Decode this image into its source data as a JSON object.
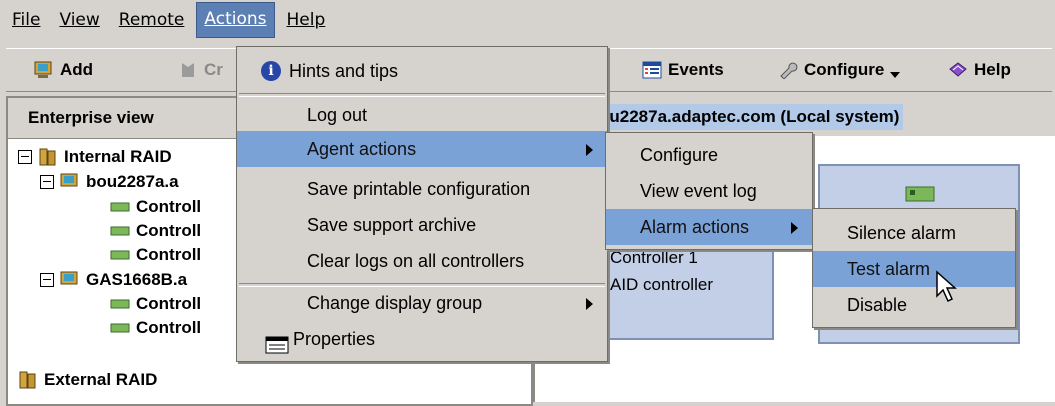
{
  "menubar": {
    "items": [
      {
        "label": "File"
      },
      {
        "label": "View"
      },
      {
        "label": "Remote"
      },
      {
        "label": "Actions"
      },
      {
        "label": "Help"
      }
    ]
  },
  "toolbar": {
    "add_label": "Add",
    "create_label": "Cr",
    "events_label": "Events",
    "configure_label": "Configure",
    "help_label": "Help"
  },
  "enterprise": {
    "title": "Enterprise view",
    "tree": [
      {
        "label": "Internal RAID"
      },
      {
        "label": "bou2287a.a"
      },
      {
        "label": "Controll"
      },
      {
        "label": "Controll"
      },
      {
        "label": "Controll"
      },
      {
        "label": "GAS1668B.a"
      },
      {
        "label": "Controll"
      },
      {
        "label": "Controll"
      },
      {
        "label": "External RAID"
      }
    ]
  },
  "right": {
    "header": "ou2287a.adaptec.com (Local system)",
    "card_line1": "Controller 1",
    "card_line2": "AID controller"
  },
  "actions_menu": {
    "items": [
      {
        "label": "Hints and tips"
      },
      {
        "label": "Log out"
      },
      {
        "label": "Agent actions"
      },
      {
        "label": "Save printable configuration"
      },
      {
        "label": "Save support archive"
      },
      {
        "label": "Clear logs on all controllers"
      },
      {
        "label": "Change display group"
      },
      {
        "label": "Properties"
      }
    ]
  },
  "agent_menu": {
    "items": [
      {
        "label": "Configure"
      },
      {
        "label": "View event log"
      },
      {
        "label": "Alarm actions"
      }
    ]
  },
  "alarm_menu": {
    "items": [
      {
        "label": "Silence alarm"
      },
      {
        "label": "Test alarm"
      },
      {
        "label": "Disable"
      }
    ]
  },
  "colors": {
    "highlight": "#7aa2d7",
    "window_bg": "#d6d3ce",
    "card": "#c3cfe6"
  }
}
